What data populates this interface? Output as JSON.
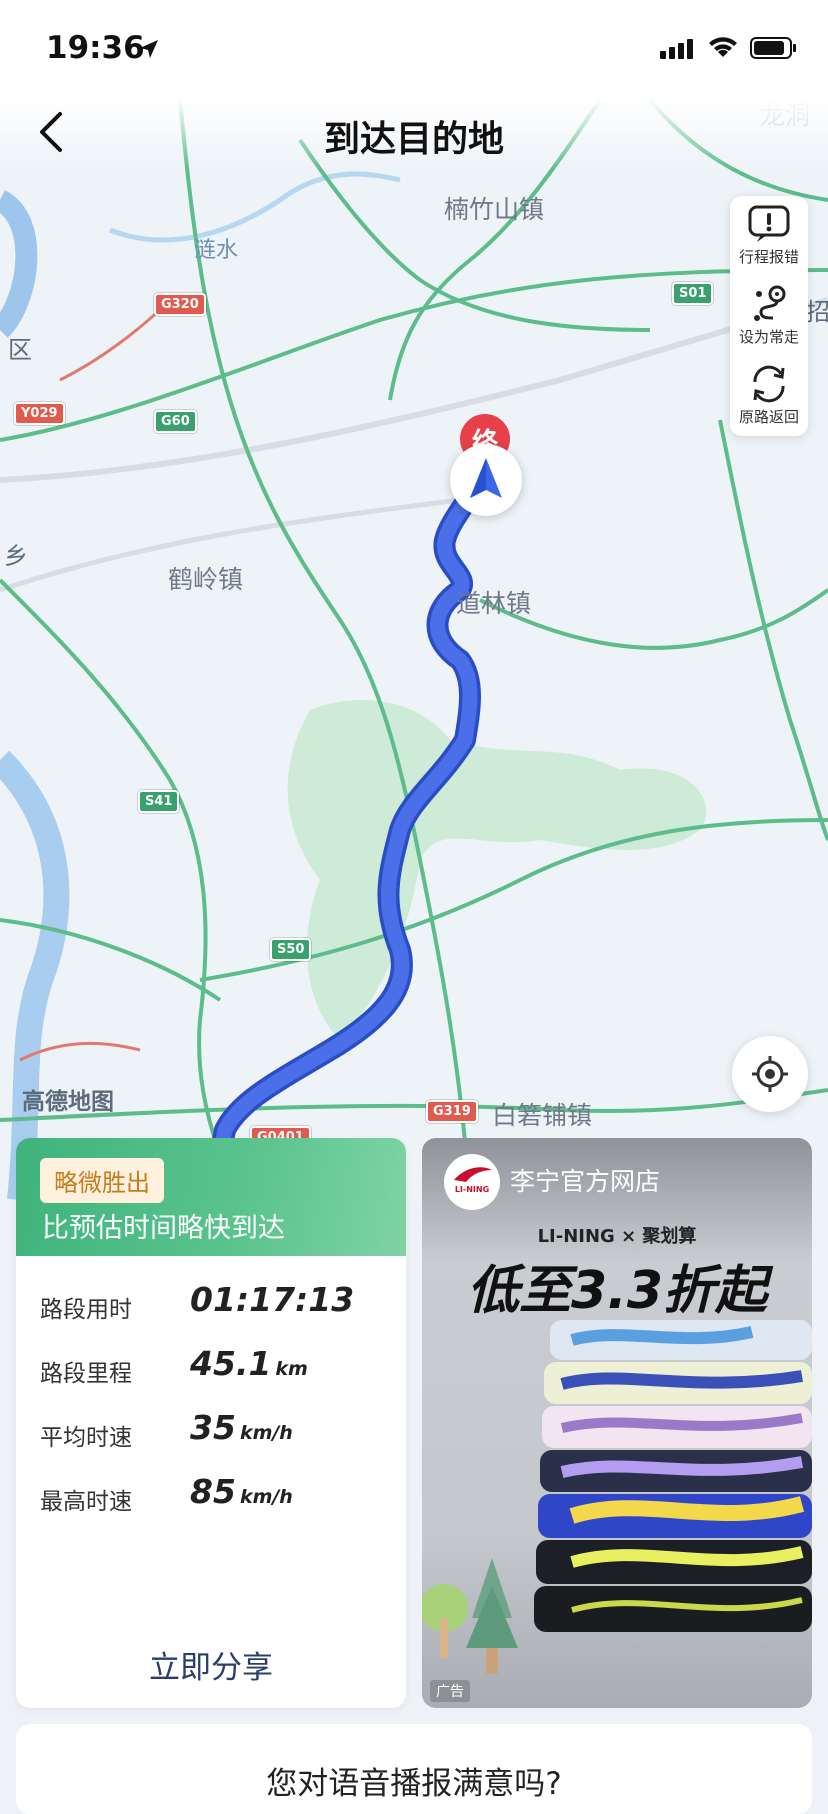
{
  "status_bar": {
    "time": "19:36"
  },
  "header": {
    "title": "到达目的地"
  },
  "map": {
    "places": {
      "nanzhushan": "楠竹山镇",
      "helingzhen": "鹤岭镇",
      "daolinzhen": "道林镇",
      "baizhupu": "白箬铺镇",
      "longdong": "龙洞",
      "lianshui": "涟水",
      "district": "区",
      "xiang": "乡",
      "zhao": "招"
    },
    "roads": [
      "G320",
      "G60",
      "Y029",
      "S01",
      "S41",
      "S50",
      "G319",
      "G0401"
    ],
    "end_marker": "终",
    "attribution": "高德地图"
  },
  "tools": [
    {
      "label": "行程报错",
      "icon": "report-error-icon"
    },
    {
      "label": "设为常走",
      "icon": "route-favorite-icon"
    },
    {
      "label": "原路返回",
      "icon": "return-route-icon"
    }
  ],
  "stats": {
    "badge": "略微胜出",
    "subtitle": "比预估时间略快到达",
    "rows": [
      {
        "label": "路段用时",
        "value": "01:17:13",
        "unit": ""
      },
      {
        "label": "路段里程",
        "value": "45.1",
        "unit": "km"
      },
      {
        "label": "平均时速",
        "value": "35",
        "unit": "km/h"
      },
      {
        "label": "最高时速",
        "value": "85",
        "unit": "km/h"
      }
    ],
    "share_label": "立即分享"
  },
  "ad": {
    "logo_text": "LI-NING",
    "shop_name": "李宁官方网店",
    "brands": "LI-NING × 聚划算",
    "headline": "低至3.3折起",
    "tag": "广告"
  },
  "feedback": {
    "question": "您对语音播报满意吗?"
  },
  "colors": {
    "route": "#4a6fe8",
    "accent_green": "#3fb37c",
    "road_green": "#43b47a"
  }
}
